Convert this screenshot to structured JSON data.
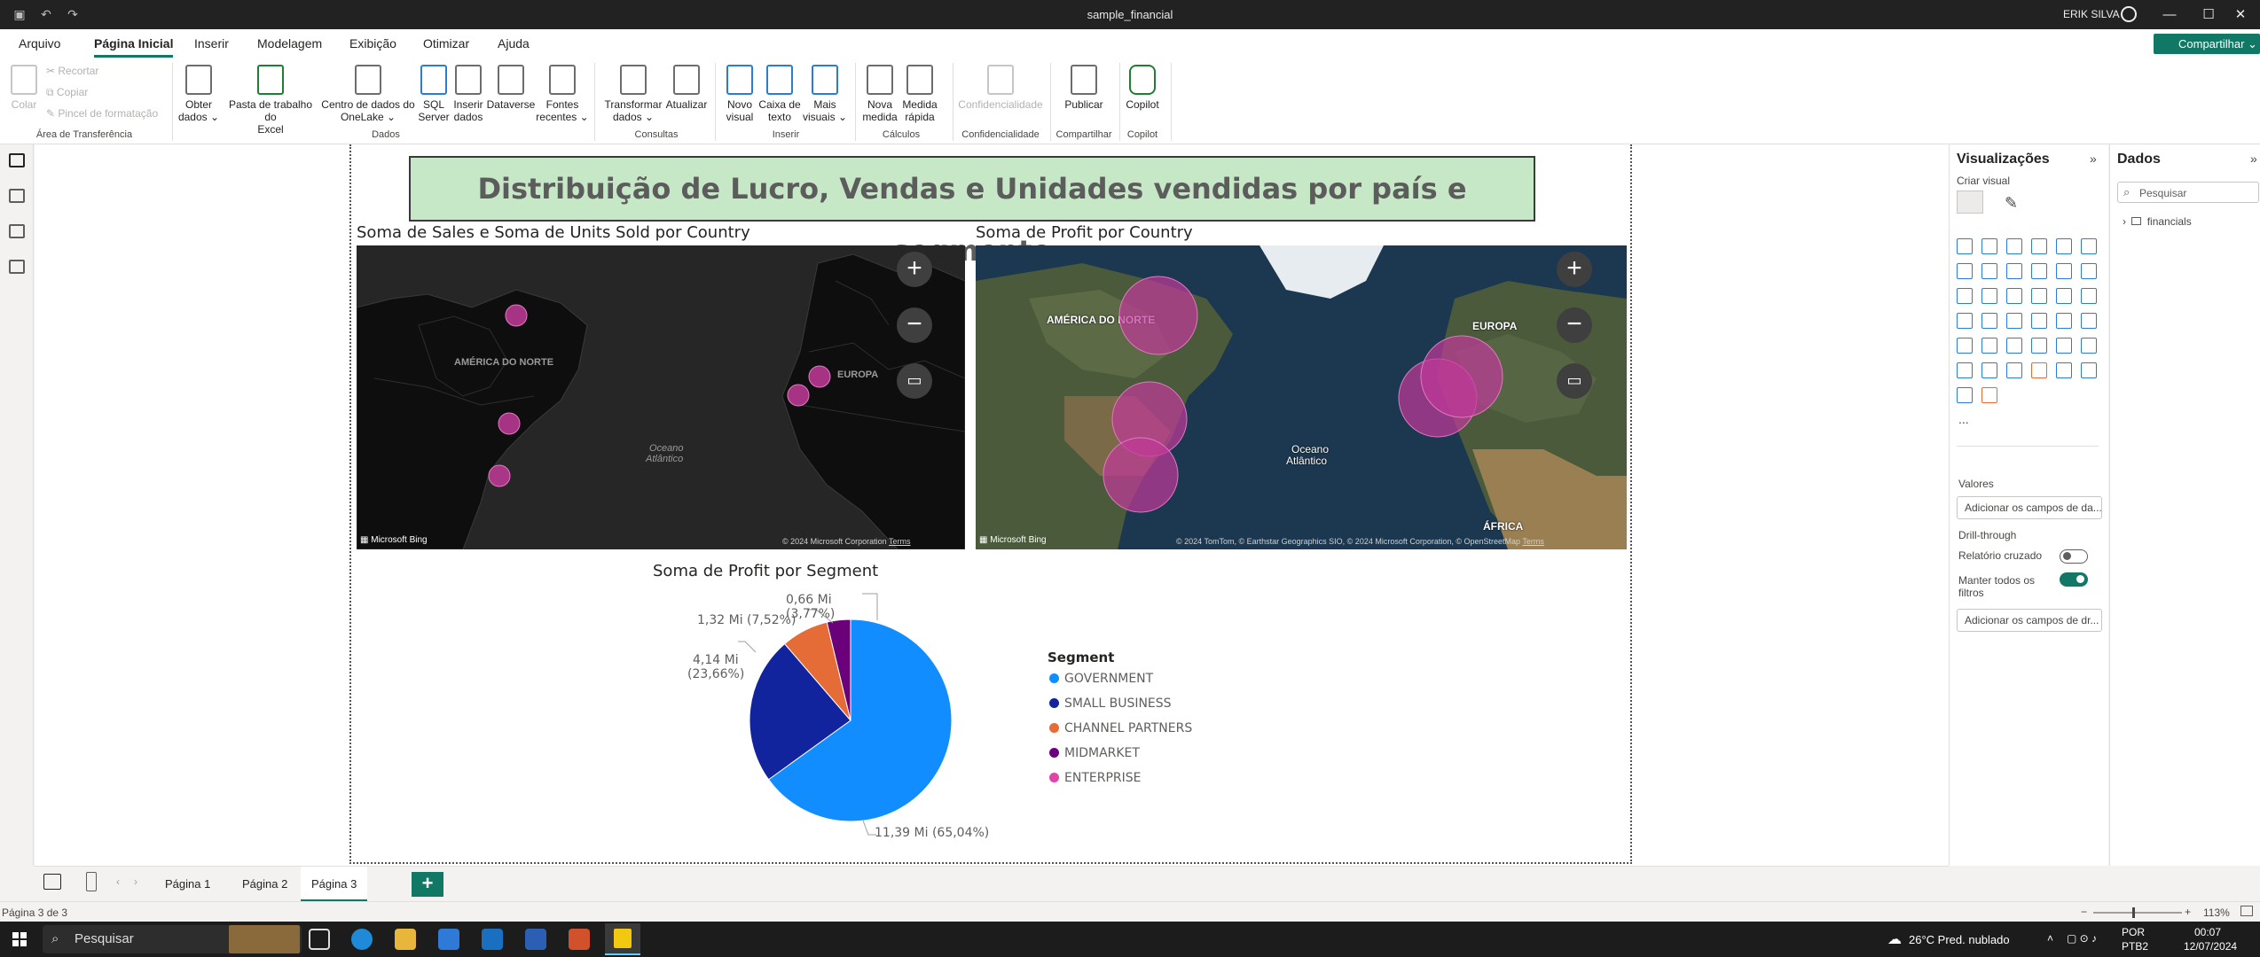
{
  "window": {
    "title": "sample_financial",
    "user": "ERIK SILVA",
    "share_label": "Compartilhar"
  },
  "menu": {
    "tabs": [
      "Arquivo",
      "Página Inicial",
      "Inserir",
      "Modelagem",
      "Exibição",
      "Otimizar",
      "Ajuda"
    ],
    "active": "Página Inicial"
  },
  "ribbon": {
    "clipboard": {
      "paste": "Colar",
      "cut": "Recortar",
      "copy": "Copiar",
      "format_painter": "Pincel de formatação",
      "group": "Área de Transferência"
    },
    "data": {
      "get_data_1": "Obter",
      "get_data_2": "dados ⌄",
      "excel_1": "Pasta de trabalho do",
      "excel_2": "Excel",
      "onelake_1": "Centro de dados do",
      "onelake_2": "OneLake ⌄",
      "sql_1": "SQL",
      "sql_2": "Server",
      "enter_1": "Inserir",
      "enter_2": "dados",
      "dataverse": "Dataverse",
      "recent_1": "Fontes",
      "recent_2": "recentes ⌄",
      "group": "Dados"
    },
    "queries": {
      "transform_1": "Transformar",
      "transform_2": "dados ⌄",
      "refresh": "Atualizar",
      "group": "Consultas"
    },
    "insert": {
      "visual_1": "Novo",
      "visual_2": "visual",
      "textbox_1": "Caixa de",
      "textbox_2": "texto",
      "more_1": "Mais",
      "more_2": "visuais ⌄",
      "group": "Inserir"
    },
    "calc": {
      "measure_1": "Nova",
      "measure_2": "medida",
      "quick_1": "Medida",
      "quick_2": "rápida",
      "group": "Cálculos"
    },
    "sensitivity": {
      "label": "Confidencialidade",
      "group": "Confidencialidade"
    },
    "share": {
      "publish": "Publicar",
      "group": "Compartilhar"
    },
    "copilot": {
      "label": "Copilot",
      "group": "Copilot"
    }
  },
  "report": {
    "title": "Distribuição de Lucro, Vendas e Unidades vendidas por país e segmento",
    "map1_title": "Soma de Sales e Soma de Units Sold por Country",
    "map2_title": "Soma de Profit por Country",
    "pie_title": "Soma de Profit por Segment",
    "map1": {
      "label_na": "AMÉRICA DO NORTE",
      "label_eu": "EUROPA",
      "label_ocean_1": "Oceano",
      "label_ocean_2": "Atlântico",
      "bing": "Microsoft Bing",
      "copyright": "© 2024 Microsoft Corporation",
      "terms": "Terms"
    },
    "map2": {
      "label_na": "AMÉRICA DO NORTE",
      "label_eu": "EUROPA",
      "label_af": "ÁFRICA",
      "label_ocean_1": "Oceano",
      "label_ocean_2": "Atlântico",
      "bing": "Microsoft Bing",
      "copyright": "© 2024 TomTom, © Earthstar Geographics SIO, © 2024 Microsoft Corporation, © OpenStreetMap",
      "terms": "Terms"
    },
    "legend_title": "Segment"
  },
  "chart_data": {
    "type": "pie",
    "title": "Soma de Profit por Segment",
    "legend_title": "Segment",
    "categories": [
      "GOVERNMENT",
      "SMALL BUSINESS",
      "CHANNEL PARTNERS",
      "MIDMARKET",
      "ENTERPRISE"
    ],
    "values": [
      11.39,
      4.14,
      1.32,
      0.66,
      0
    ],
    "percents": [
      65.04,
      23.66,
      7.52,
      3.77,
      0
    ],
    "colors": [
      "#118dff",
      "#12239e",
      "#e66c37",
      "#6b007b",
      "#e044a7"
    ],
    "data_labels": {
      "GOVERNMENT": "11,39 Mi (65,04%)",
      "SMALL BUSINESS_1": "4,14 Mi",
      "SMALL BUSINESS_2": "(23,66%)",
      "CHANNEL PARTNERS": "1,32 Mi (7,52%)",
      "MIDMARKET_1": "0,66 Mi",
      "MIDMARKET_2": "(3,77%)"
    }
  },
  "visualizations_pane": {
    "title": "Visualizações",
    "build_visual": "Criar visual",
    "more": "...",
    "values_label": "Valores",
    "values_well": "Adicionar os campos de da...",
    "drillthrough": "Drill-through",
    "cross_report": "Relatório cruzado",
    "keep_filters_1": "Manter todos os",
    "keep_filters_2": "filtros",
    "drill_well": "Adicionar os campos de dr...",
    "cross_report_on": false,
    "keep_filters_on": true
  },
  "data_pane": {
    "title": "Dados",
    "search_placeholder": "Pesquisar",
    "tables": [
      "financials"
    ]
  },
  "pages": {
    "tabs": [
      "Página 1",
      "Página 2",
      "Página 3"
    ],
    "active": "Página 3",
    "add": "+"
  },
  "status": {
    "page": "Página 3 de 3",
    "zoom": "113%"
  },
  "taskbar": {
    "search": "Pesquisar",
    "weather": "26°C  Pred. nublado",
    "lang_1": "POR",
    "lang_2": "PTB2",
    "time": "00:07",
    "date": "12/07/2024"
  },
  "colors": {
    "accent": "#117865",
    "title_bg": "#c6e8c6",
    "bubble": "#c2399a"
  }
}
